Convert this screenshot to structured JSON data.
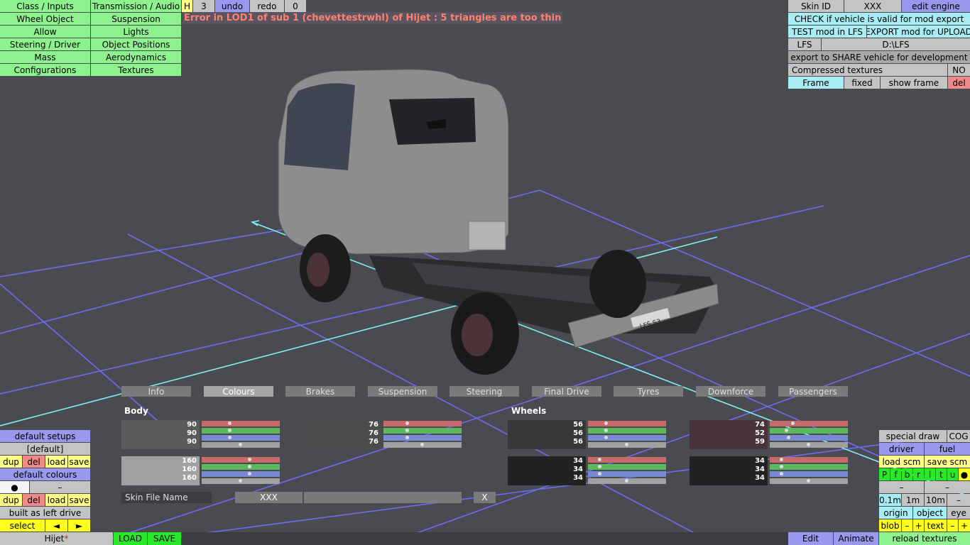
{
  "top_left_menu": {
    "col1": [
      "Class / Inputs",
      "Wheel Object",
      "Allow",
      "Steering / Driver",
      "Mass",
      "Configurations"
    ],
    "col2": [
      "Transmission / Audio",
      "Suspension",
      "Lights",
      "Object Positions",
      "Aerodynamics",
      "Textures"
    ]
  },
  "toolbar": {
    "h": "H",
    "num": "3",
    "undo": "undo",
    "redo": "redo",
    "count": "0"
  },
  "error": "Error in LOD1 of sub 1 (chevettestrwhl) of Hijet : 5 triangles are too thin",
  "top_right": {
    "skin_id": "Skin ID",
    "skin_val": "XXX",
    "edit_engine": "edit engine",
    "check": "CHECK if vehicle is valid for mod export",
    "test": "TEST mod in LFS",
    "export": "EXPORT mod for UPLOAD",
    "lfs": "LFS",
    "path": "D:\\LFS",
    "share": "export to SHARE vehicle for development",
    "compressed": "Compressed textures",
    "compressed_val": "NO",
    "frame": "Frame",
    "fixed": "fixed",
    "show_frame": "show frame",
    "del": "del"
  },
  "viewport": {
    "plate": "LFS S3"
  },
  "tabs": [
    "Info",
    "Colours",
    "Brakes",
    "Suspension",
    "Steering",
    "Final Drive",
    "Tyres",
    "Downforce",
    "Passengers"
  ],
  "colours": {
    "body_label": "Body",
    "wheels_label": "Wheels",
    "body1": {
      "vals": [
        "90",
        "90",
        "90"
      ],
      "color": "#5a5a5a"
    },
    "body2": {
      "vals": [
        "76",
        "76",
        "76"
      ],
      "color": "#4c4c4c"
    },
    "body3": {
      "vals": [
        "160",
        "160",
        "160"
      ],
      "color": "#a0a0a0"
    },
    "wheel1": {
      "vals": [
        "56",
        "56",
        "56"
      ],
      "color": "#383838"
    },
    "wheel2": {
      "vals": [
        "74",
        "52",
        "59"
      ],
      "color": "#4a343b"
    },
    "wheel3": {
      "vals": [
        "34",
        "34",
        "34"
      ],
      "color": "#222222"
    },
    "wheel4": {
      "vals": [
        "34",
        "34",
        "34"
      ],
      "color": "#222222"
    },
    "skin_label": "Skin File Name",
    "skin_val": "XXX",
    "x_btn": "X"
  },
  "bottom_left": {
    "default_setups": "default setups",
    "default_item": "[default]",
    "dup": "dup",
    "del": "del",
    "load": "load",
    "save": "save",
    "default_colours": "default colours",
    "dot": "●",
    "dash": "–",
    "built": "built as left drive",
    "select": "select",
    "left": "◄",
    "right": "►",
    "vehicle": "Hijet",
    "star": "*",
    "load_btn": "LOAD",
    "save_btn": "SAVE"
  },
  "bottom_right": {
    "special": "special draw",
    "cog": "COG",
    "driver": "driver",
    "fuel": "fuel",
    "load_scm": "load scm",
    "save_scm": "save scm",
    "letters": [
      "P",
      "f",
      "b",
      "r",
      "l",
      "t",
      "u",
      "●"
    ],
    "dash": "–",
    "m01": "0.1m",
    "m1": "1m",
    "m10": "10m",
    "origin": "origin",
    "object": "object",
    "eye": "eye",
    "blob": "blob",
    "minus": "–",
    "plus": "+",
    "text": "text",
    "reload": "reload textures",
    "edit": "Edit",
    "animate": "Animate"
  }
}
